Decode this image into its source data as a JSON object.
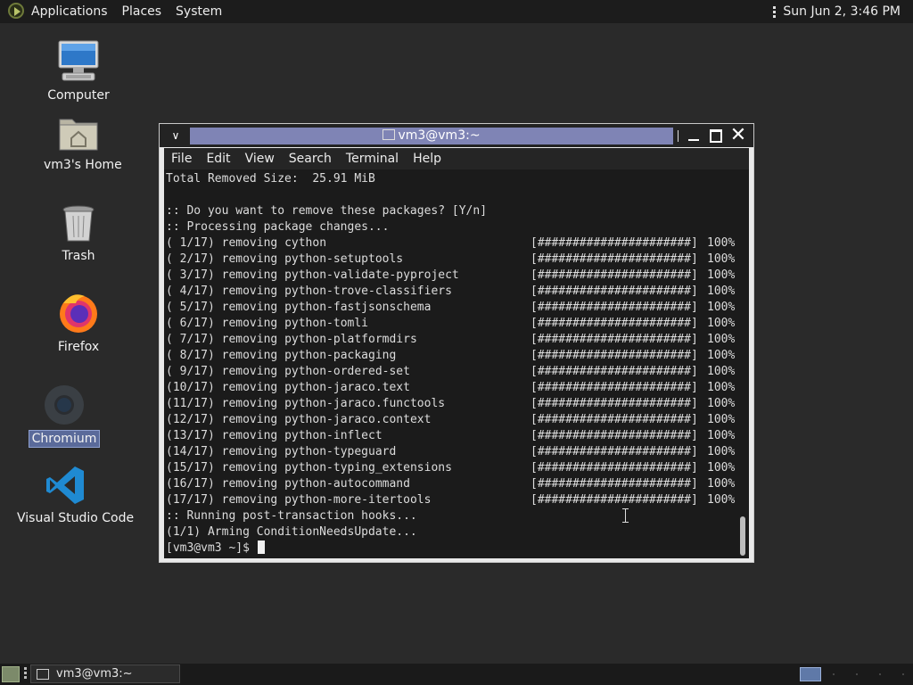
{
  "top_panel": {
    "menus": [
      "Applications",
      "Places",
      "System"
    ],
    "clock": "Sun Jun  2,  3:46 PM"
  },
  "desktop_icons": [
    {
      "label": "Computer",
      "icon": "computer-icon"
    },
    {
      "label": "vm3's Home",
      "icon": "home-folder-icon"
    },
    {
      "label": "Trash",
      "icon": "trash-icon"
    },
    {
      "label": "Firefox",
      "icon": "firefox-icon"
    },
    {
      "label": "Chromium",
      "icon": "chromium-icon"
    },
    {
      "label": "Visual Studio Code",
      "icon": "vscode-icon"
    }
  ],
  "window": {
    "title": "vm3@vm3:~",
    "menu": [
      "File",
      "Edit",
      "View",
      "Search",
      "Terminal",
      "Help"
    ]
  },
  "terminal": {
    "pre_lines": [
      "Total Removed Size:  25.91 MiB",
      "",
      ":: Do you want to remove these packages? [Y/n]",
      ":: Processing package changes..."
    ],
    "progress": [
      {
        "idx": "( 1/17)",
        "pkg": "cython"
      },
      {
        "idx": "( 2/17)",
        "pkg": "python-setuptools"
      },
      {
        "idx": "( 3/17)",
        "pkg": "python-validate-pyproject"
      },
      {
        "idx": "( 4/17)",
        "pkg": "python-trove-classifiers"
      },
      {
        "idx": "( 5/17)",
        "pkg": "python-fastjsonschema"
      },
      {
        "idx": "( 6/17)",
        "pkg": "python-tomli"
      },
      {
        "idx": "( 7/17)",
        "pkg": "python-platformdirs"
      },
      {
        "idx": "( 8/17)",
        "pkg": "python-packaging"
      },
      {
        "idx": "( 9/17)",
        "pkg": "python-ordered-set"
      },
      {
        "idx": "(10/17)",
        "pkg": "python-jaraco.text"
      },
      {
        "idx": "(11/17)",
        "pkg": "python-jaraco.functools"
      },
      {
        "idx": "(12/17)",
        "pkg": "python-jaraco.context"
      },
      {
        "idx": "(13/17)",
        "pkg": "python-inflect"
      },
      {
        "idx": "(14/17)",
        "pkg": "python-typeguard"
      },
      {
        "idx": "(15/17)",
        "pkg": "python-typing_extensions"
      },
      {
        "idx": "(16/17)",
        "pkg": "python-autocommand"
      },
      {
        "idx": "(17/17)",
        "pkg": "python-more-itertools"
      }
    ],
    "action": "removing",
    "bar": "[######################]",
    "pct": "100%",
    "post_lines": [
      ":: Running post-transaction hooks...",
      "(1/1) Arming ConditionNeedsUpdate..."
    ],
    "prompt": "[vm3@vm3 ~]$ "
  },
  "bottom_panel": {
    "task_label": "vm3@vm3:~"
  }
}
